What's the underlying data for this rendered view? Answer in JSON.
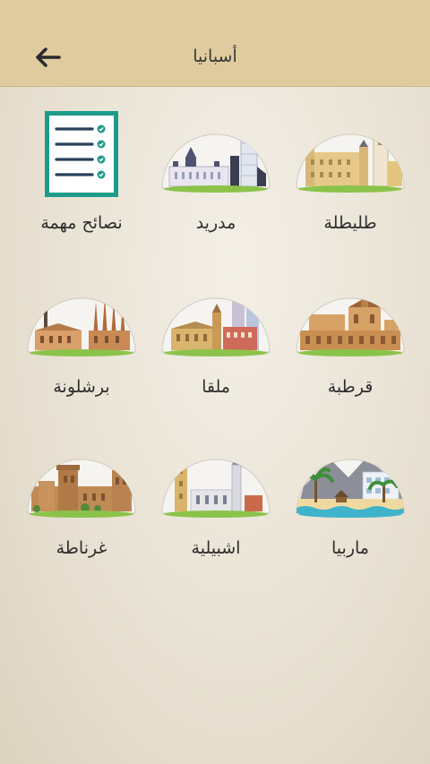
{
  "header": {
    "title": "أسبانيا",
    "back_icon": "arrow-left-icon"
  },
  "cities": [
    {
      "id": "toledo",
      "label": "طليطلة",
      "icon": "toledo-skyline-icon"
    },
    {
      "id": "madrid",
      "label": "مدريد",
      "icon": "madrid-skyline-icon"
    },
    {
      "id": "tips",
      "label": "نصائح مهمة",
      "icon": "checklist-icon"
    },
    {
      "id": "cordoba",
      "label": "قرطبة",
      "icon": "cordoba-mosque-icon"
    },
    {
      "id": "malaga",
      "label": "ملقا",
      "icon": "malaga-skyline-icon"
    },
    {
      "id": "barcelona",
      "label": "برشلونة",
      "icon": "barcelona-skyline-icon"
    },
    {
      "id": "marbella",
      "label": "ماربيا",
      "icon": "marbella-beach-icon"
    },
    {
      "id": "seville",
      "label": "اشبيلية",
      "icon": "seville-skyline-icon"
    },
    {
      "id": "granada",
      "label": "غرناطة",
      "icon": "alhambra-icon"
    }
  ],
  "colors": {
    "header": "#dfcb9d",
    "ground_green": "#8bc34a",
    "checklist_frame": "#1e9a8a",
    "checklist_lines": "#26415a"
  }
}
